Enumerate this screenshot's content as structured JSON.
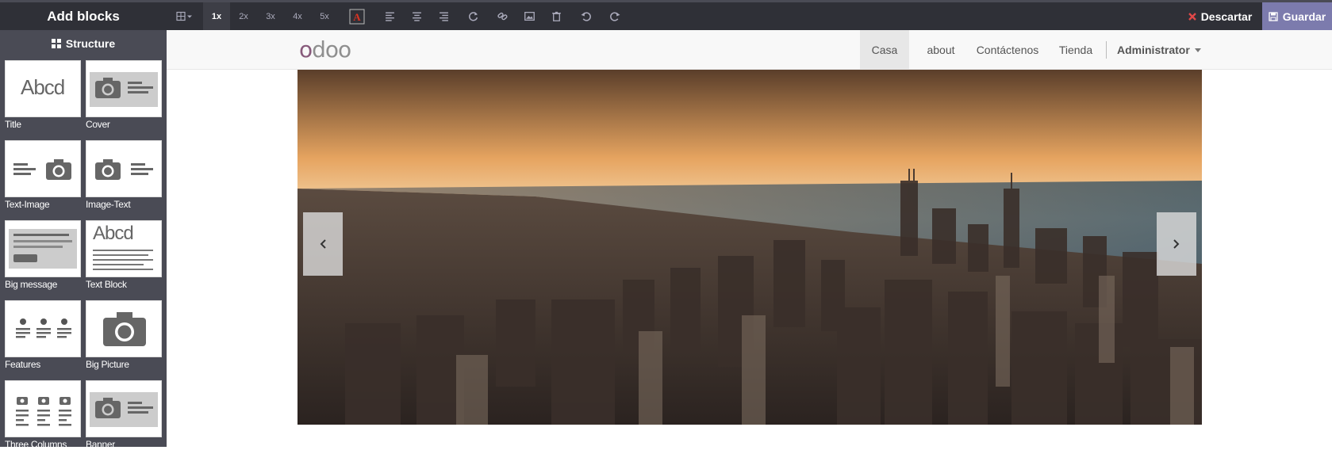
{
  "editor": {
    "panel_title": "Add blocks",
    "section_label": "Structure",
    "blocks": [
      {
        "label": "Title",
        "icon": "title-block-icon"
      },
      {
        "label": "Cover",
        "icon": "cover-block-icon"
      },
      {
        "label": "Text-Image",
        "icon": "text-image-block-icon"
      },
      {
        "label": "Image-Text",
        "icon": "image-text-block-icon"
      },
      {
        "label": "Big message",
        "icon": "big-message-block-icon"
      },
      {
        "label": "Text Block",
        "icon": "text-block-icon"
      },
      {
        "label": "Features",
        "icon": "features-block-icon"
      },
      {
        "label": "Big Picture",
        "icon": "big-picture-block-icon"
      },
      {
        "label": "Three Columns",
        "icon": "three-columns-block-icon"
      },
      {
        "label": "Banner",
        "icon": "banner-block-icon"
      }
    ],
    "title_thumb_text": "Abcd",
    "textblock_thumb_text": "Abcd"
  },
  "toolbar": {
    "sizes": [
      "1x",
      "2x",
      "3x",
      "4x",
      "5x"
    ],
    "active_size": "1x",
    "discard_label": "Descartar",
    "save_label": "Guardar",
    "icons": [
      "grid-dropdown-icon",
      "font-color-icon",
      "align-left-icon",
      "align-center-icon",
      "align-right-icon",
      "refresh-icon",
      "link-icon",
      "image-icon",
      "trash-icon",
      "undo-icon",
      "redo-icon"
    ]
  },
  "site": {
    "logo": {
      "first": "o",
      "rest": "doo"
    },
    "nav": [
      {
        "label": "Casa",
        "active": true
      },
      {
        "label": "about",
        "active": false
      },
      {
        "label": "Contáctenos",
        "active": false
      },
      {
        "label": "Tienda",
        "active": false
      }
    ],
    "user_menu": "Administrator"
  },
  "colors": {
    "topbar": "#2f3037",
    "panel": "#4a4b55",
    "save_button": "#7c7bad",
    "logo_accent": "#875a7b",
    "discard_icon": "#e04848"
  }
}
